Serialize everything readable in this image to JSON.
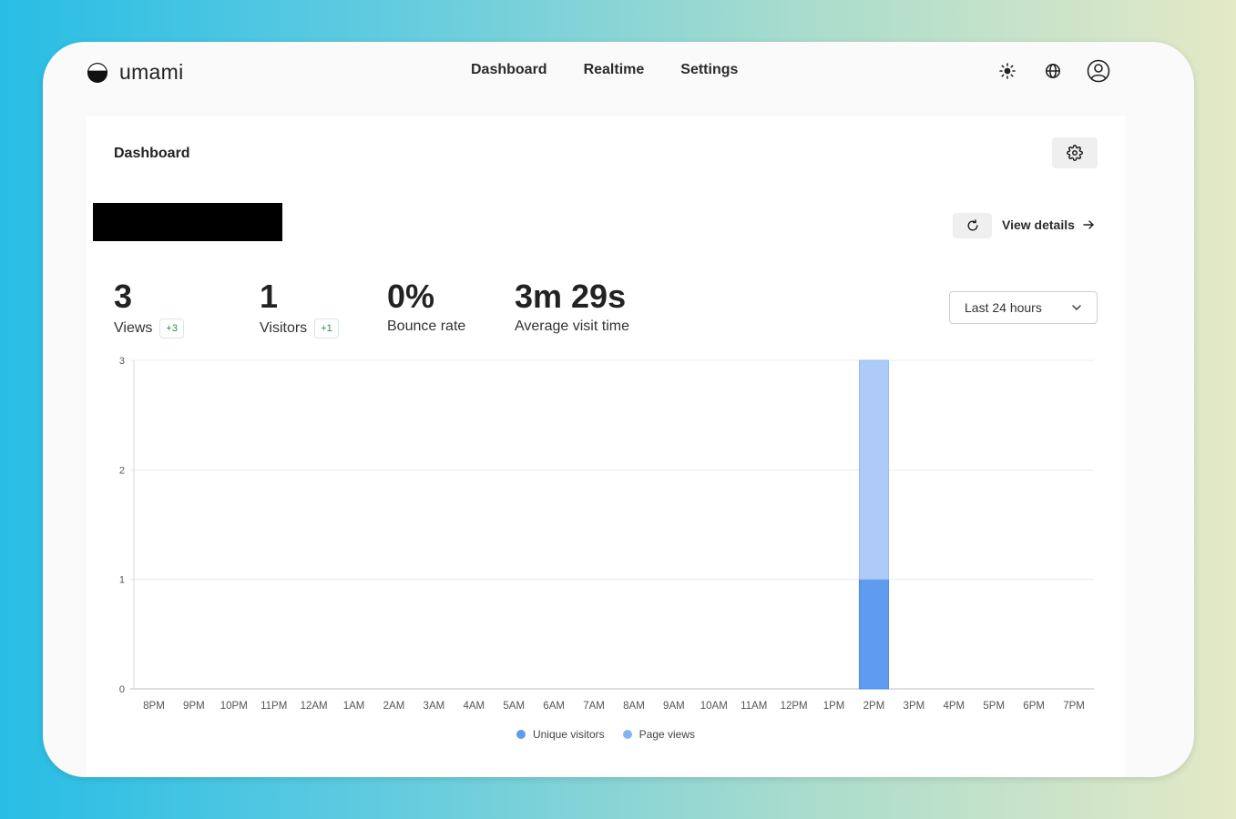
{
  "app": {
    "name": "umami"
  },
  "nav": [
    {
      "label": "Dashboard"
    },
    {
      "label": "Realtime"
    },
    {
      "label": "Settings"
    }
  ],
  "page": {
    "title": "Dashboard"
  },
  "website": {
    "view_details_label": "View details"
  },
  "metrics": [
    {
      "value": "3",
      "label": "Views",
      "change": "+3"
    },
    {
      "value": "1",
      "label": "Visitors",
      "change": "+1"
    },
    {
      "value": "0%",
      "label": "Bounce rate",
      "change": ""
    },
    {
      "value": "3m 29s",
      "label": "Average visit time",
      "change": ""
    }
  ],
  "date_range": {
    "selected": "Last 24 hours"
  },
  "colors": {
    "unique_visitors": "#5f9bef",
    "page_views": "#adcbf6"
  },
  "chart_data": {
    "type": "bar",
    "stacked": true,
    "categories": [
      "8PM",
      "9PM",
      "10PM",
      "11PM",
      "12AM",
      "1AM",
      "2AM",
      "3AM",
      "4AM",
      "5AM",
      "6AM",
      "7AM",
      "8AM",
      "9AM",
      "10AM",
      "11AM",
      "12PM",
      "1PM",
      "2PM",
      "3PM",
      "4PM",
      "5PM",
      "6PM",
      "7PM"
    ],
    "series": [
      {
        "name": "Unique visitors",
        "color": "#5f9bef",
        "values": [
          0,
          0,
          0,
          0,
          0,
          0,
          0,
          0,
          0,
          0,
          0,
          0,
          0,
          0,
          0,
          0,
          0,
          0,
          1,
          0,
          0,
          0,
          0,
          0
        ]
      },
      {
        "name": "Page views",
        "color": "#adcbf6",
        "values": [
          0,
          0,
          0,
          0,
          0,
          0,
          0,
          0,
          0,
          0,
          0,
          0,
          0,
          0,
          0,
          0,
          0,
          0,
          2,
          0,
          0,
          0,
          0,
          0
        ]
      }
    ],
    "yticks": [
      0,
      1,
      2,
      3
    ],
    "ylim": [
      0,
      3
    ],
    "grid": true,
    "legend_position": "bottom"
  }
}
